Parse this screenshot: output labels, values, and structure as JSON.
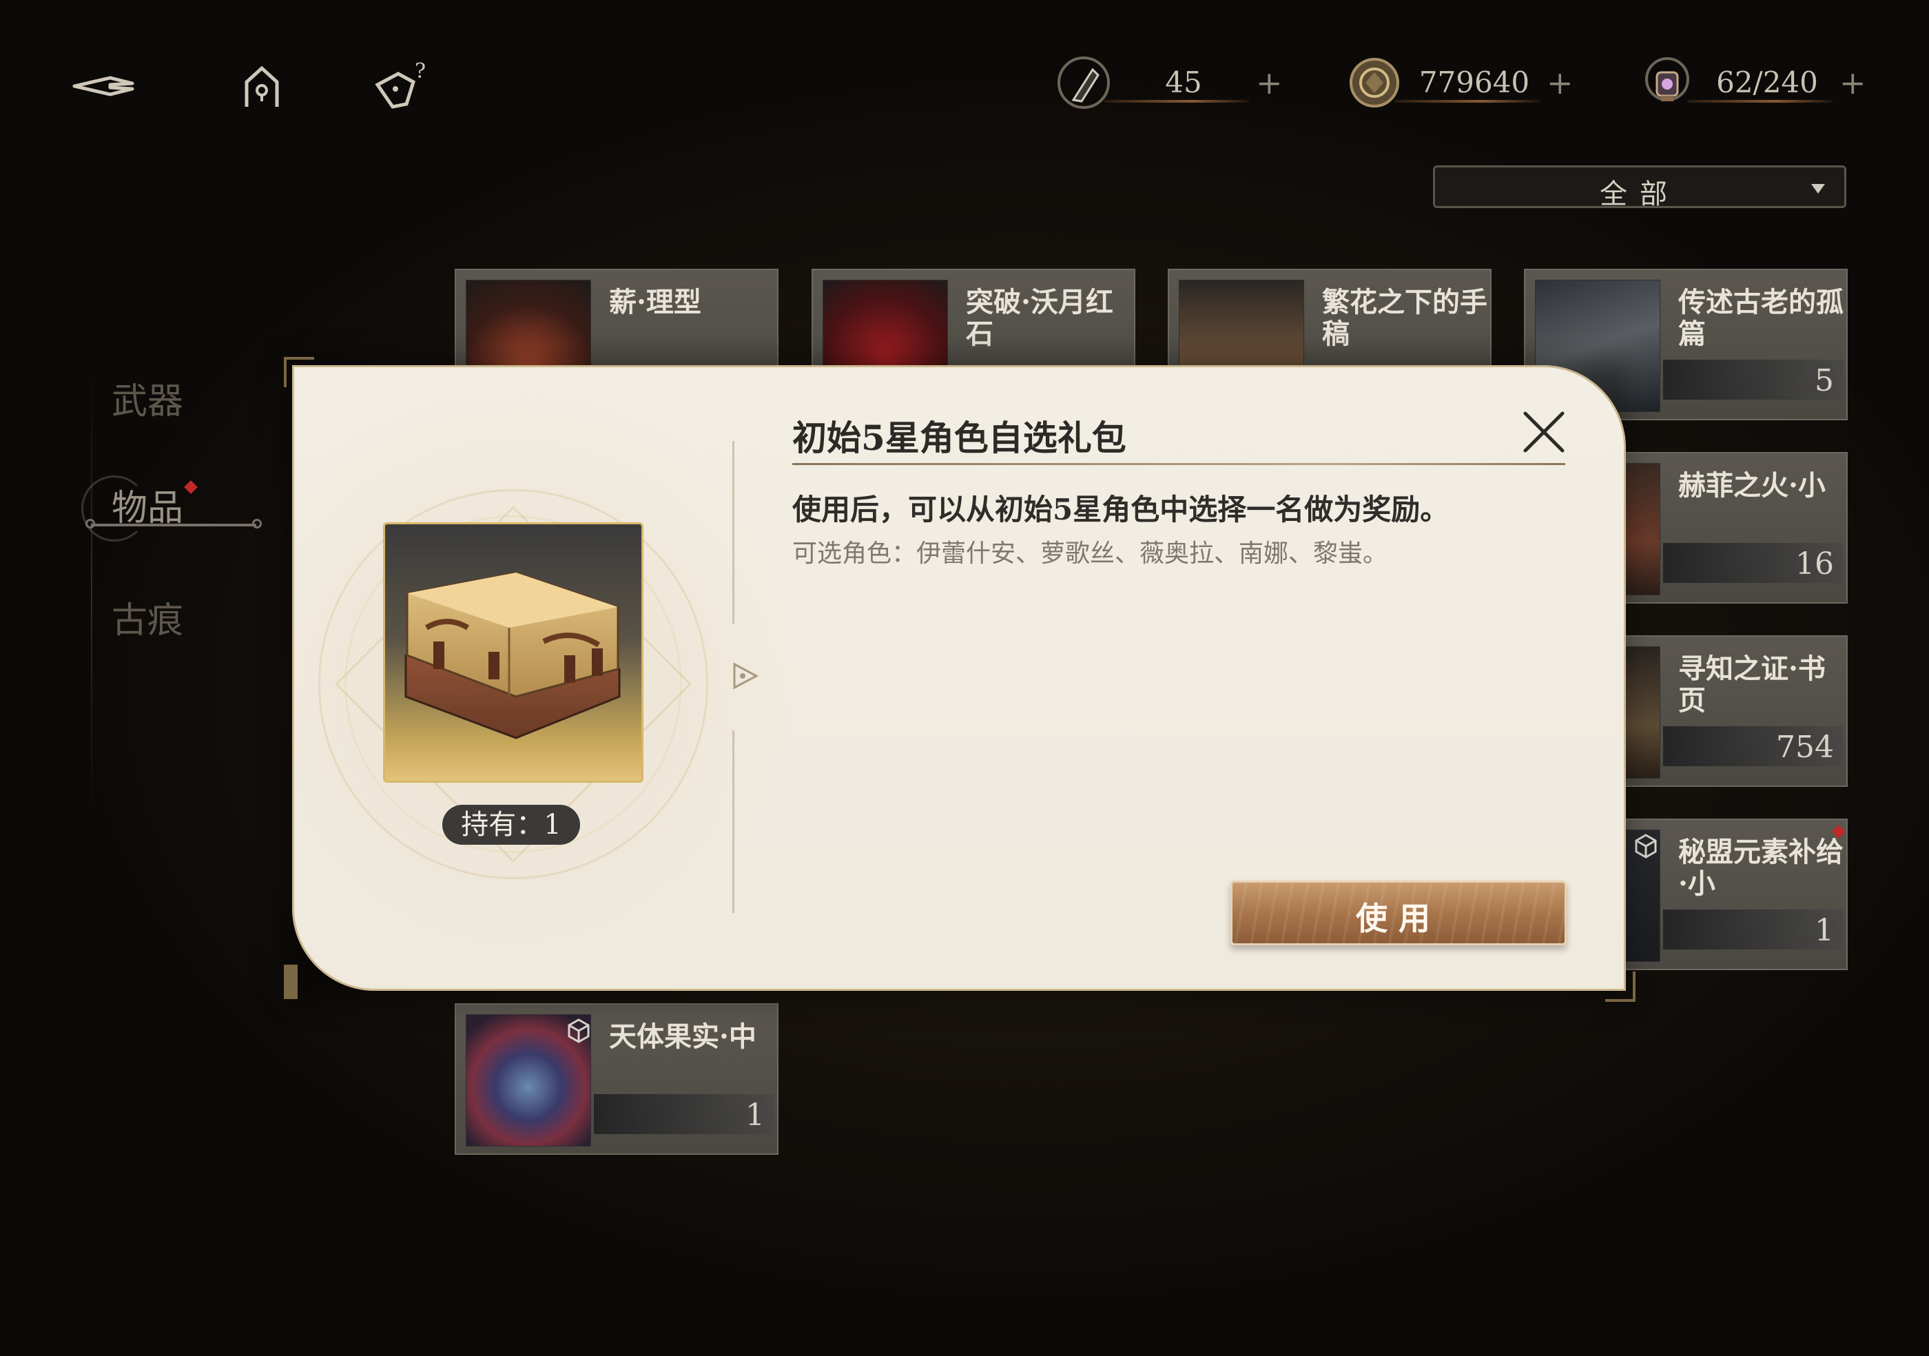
{
  "currencies": [
    {
      "value": "45",
      "plus": "+",
      "icon": "quill-stamina-icon"
    },
    {
      "value": "779640",
      "plus": "+",
      "icon": "coin-icon"
    },
    {
      "value": "62/240",
      "plus": "+",
      "icon": "lantern-icon"
    }
  ],
  "filter": {
    "label": "全部"
  },
  "tabs": [
    "武器",
    "物品",
    "古痕"
  ],
  "cards": [
    {
      "name": "薪·理型",
      "qty": ""
    },
    {
      "name": "突破·沃月红石",
      "qty": ""
    },
    {
      "name": "繁花之下的手稿",
      "qty": ""
    },
    {
      "name": "传述古老的孤篇",
      "qty": "5"
    },
    {
      "name": "赫菲之火·小",
      "qty": "16"
    },
    {
      "name": "寻知之证·书页",
      "qty": "754"
    },
    {
      "name": "秘盟元素补给·小",
      "qty": "1"
    },
    {
      "name": "天体果实·中",
      "qty": "1"
    }
  ],
  "dialog": {
    "title": "初始5星角色自选礼包",
    "description": "使用后，可以从初始5星角色中选择一名做为奖励。",
    "sub": "可选角色：伊蕾什安、萝歌丝、薇奥拉、南娜、黎蚩。",
    "hold": "持有：1",
    "use_button": "使用"
  },
  "colors": {
    "accent_gold": "#d7b76b",
    "use_button": "#a67349",
    "dialog_bg": "#f1ece2",
    "red_badge": "#c02828"
  }
}
